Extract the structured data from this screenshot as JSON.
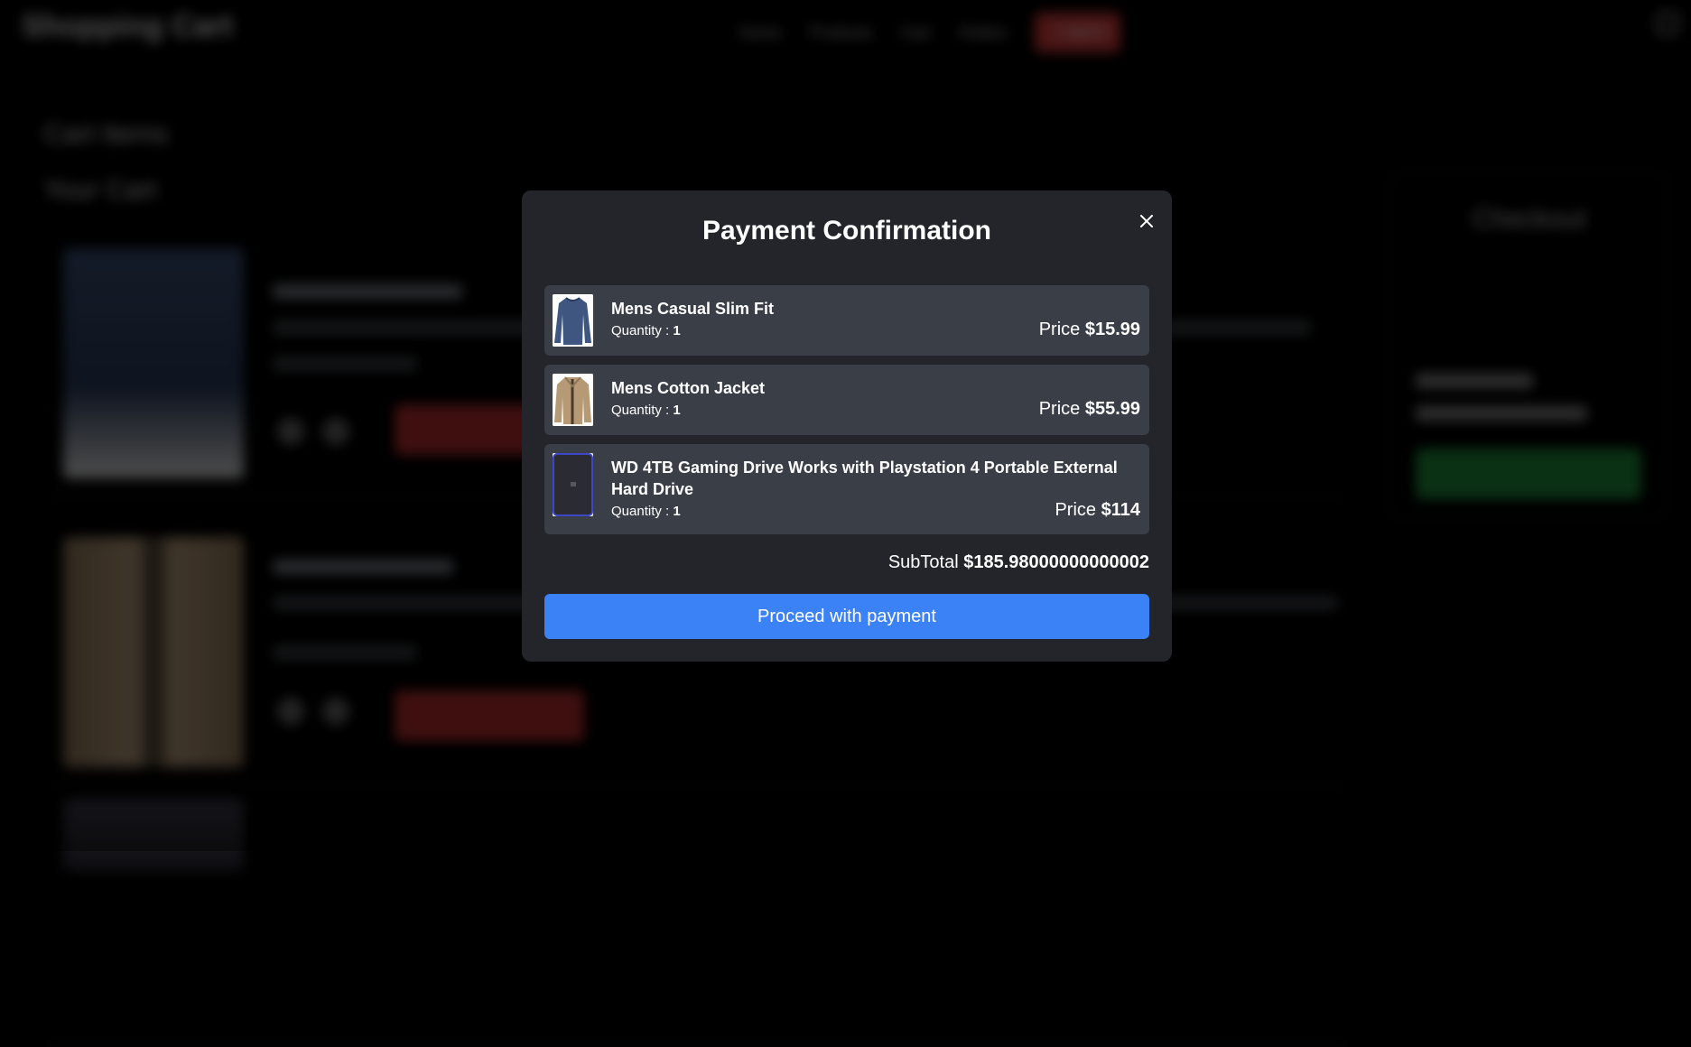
{
  "background": {
    "logo": "Shopping Cart",
    "nav": [
      "Home",
      "Products",
      "Cart",
      "Orders",
      "Logout"
    ],
    "heading_1": "Cart Items",
    "heading_2": "Your Cart",
    "checkout_title": "Checkout"
  },
  "modal": {
    "title": "Payment Confirmation",
    "close_icon": "close-icon",
    "items": [
      {
        "name": "Mens Casual Slim Fit",
        "quantity_label": "Quantity :",
        "quantity": "1",
        "price_label": "Price",
        "price": "$15.99",
        "thumb_icon": "shirt-thumbnail"
      },
      {
        "name": "Mens Cotton Jacket",
        "quantity_label": "Quantity :",
        "quantity": "1",
        "price_label": "Price",
        "price": "$55.99",
        "thumb_icon": "jacket-thumbnail"
      },
      {
        "name": "WD 4TB Gaming Drive Works with Playstation 4 Portable External Hard Drive",
        "quantity_label": "Quantity :",
        "quantity": "1",
        "price_label": "Price",
        "price": "$114",
        "thumb_icon": "hard-drive-thumbnail"
      }
    ],
    "subtotal_label": "SubTotal",
    "subtotal_value": "$185.98000000000002",
    "pay_button_label": "Proceed with payment"
  },
  "colors": {
    "modal_bg": "#23252a",
    "item_bg": "#3a3e46",
    "primary_button": "#3b82f6",
    "page_bg": "#000000"
  }
}
